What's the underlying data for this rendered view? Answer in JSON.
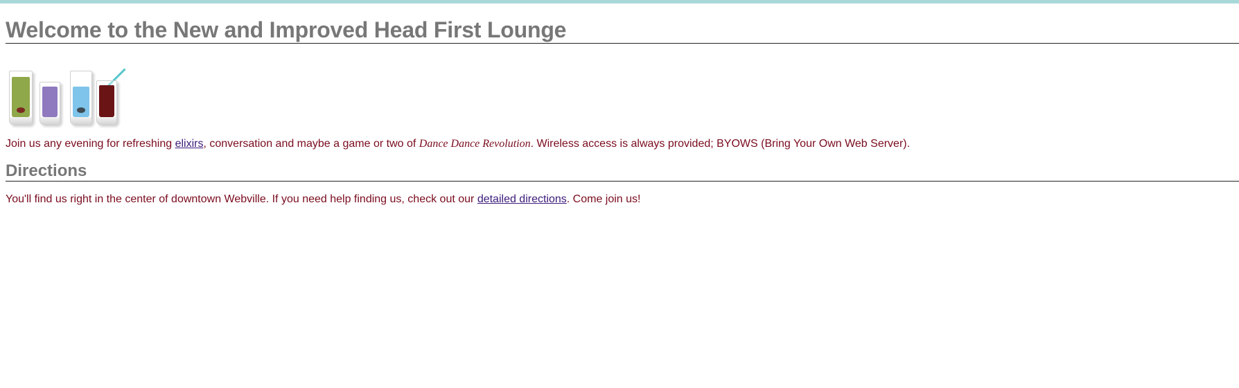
{
  "page": {
    "heading": "Welcome to the New and Improved Head First Lounge",
    "image_alt": "drinks",
    "intro": {
      "text_before_link": "Join us any evening for refreshing ",
      "link_elixirs": "elixirs",
      "text_after_link": ", conversation and maybe a game or two of ",
      "game_title": "Dance Dance Revolution",
      "text_end": ". Wireless access is always provided; BYOWS (Bring Your Own Web Server)."
    },
    "directions": {
      "heading": "Directions",
      "text_before_link": "You'll find us right in the center of downtown Webville. If you need help finding us, check out our ",
      "link_label": "detailed directions",
      "text_after_link": ". Come join us!"
    }
  },
  "colors": {
    "heading": "#777777",
    "body_text": "#7a0b1e",
    "link": "#3b1a7a",
    "top_strip": "#a9d8d8",
    "green_drink": "#8fa84a",
    "purple_drink": "#8f79bf",
    "blue_drink": "#7fc4ea",
    "red_drink": "#6a1416"
  }
}
